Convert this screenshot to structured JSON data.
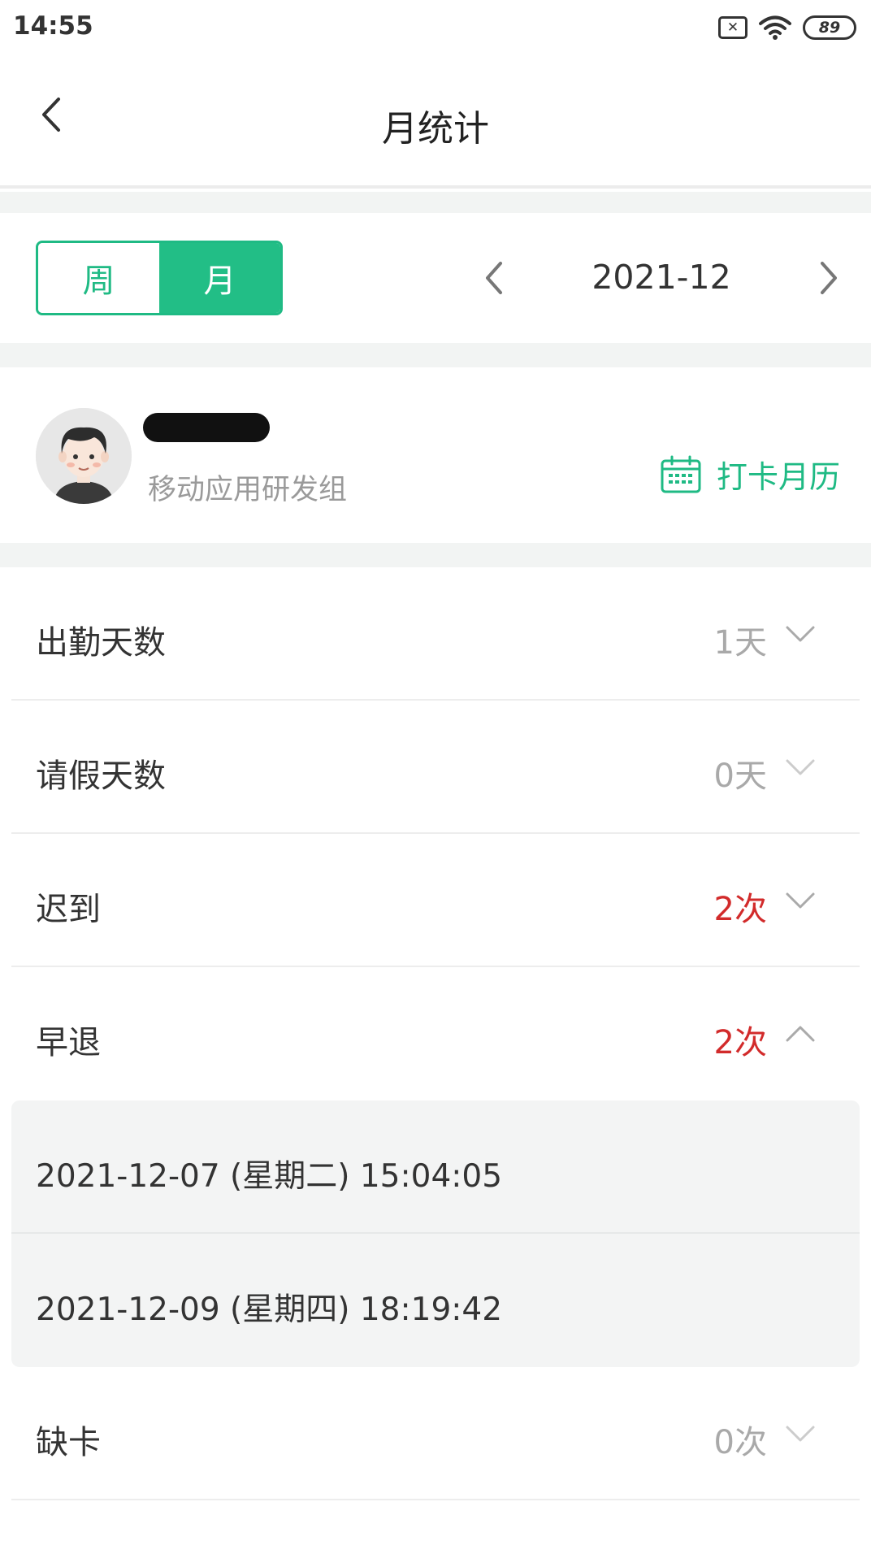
{
  "status_bar": {
    "time": "14:55",
    "sim_icon": "sim-disabled-icon",
    "sim_glyph": "✕",
    "wifi_icon": "wifi-icon",
    "battery_level": "89"
  },
  "nav": {
    "title": "月统计",
    "back_icon": "chevron-left-icon"
  },
  "period": {
    "tabs": [
      {
        "label": "周",
        "selected": false
      },
      {
        "label": "月",
        "selected": true
      }
    ],
    "value": "2021-12",
    "prev_icon": "chevron-left-icon",
    "next_icon": "chevron-right-icon"
  },
  "user": {
    "name": "",
    "name_redacted": true,
    "department": "移动应用研发组",
    "calendar_link": "打卡月历",
    "calendar_icon": "calendar-icon"
  },
  "stats": [
    {
      "label": "出勤天数",
      "value": "1天",
      "highlight": false,
      "expanded": false
    },
    {
      "label": "请假天数",
      "value": "0天",
      "highlight": false,
      "expanded": false
    },
    {
      "label": "迟到",
      "value": "2次",
      "highlight": true,
      "expanded": false
    },
    {
      "label": "早退",
      "value": "2次",
      "highlight": true,
      "expanded": true,
      "details": [
        "2021-12-07 (星期二) 15:04:05",
        "2021-12-09 (星期四) 18:19:42"
      ]
    },
    {
      "label": "缺卡",
      "value": "0次",
      "highlight": false,
      "expanded": false
    }
  ],
  "colors": {
    "accent": "#1fba84",
    "warning": "#d22b2b",
    "muted": "#a9a9a9",
    "background_gap": "#f2f4f3"
  }
}
